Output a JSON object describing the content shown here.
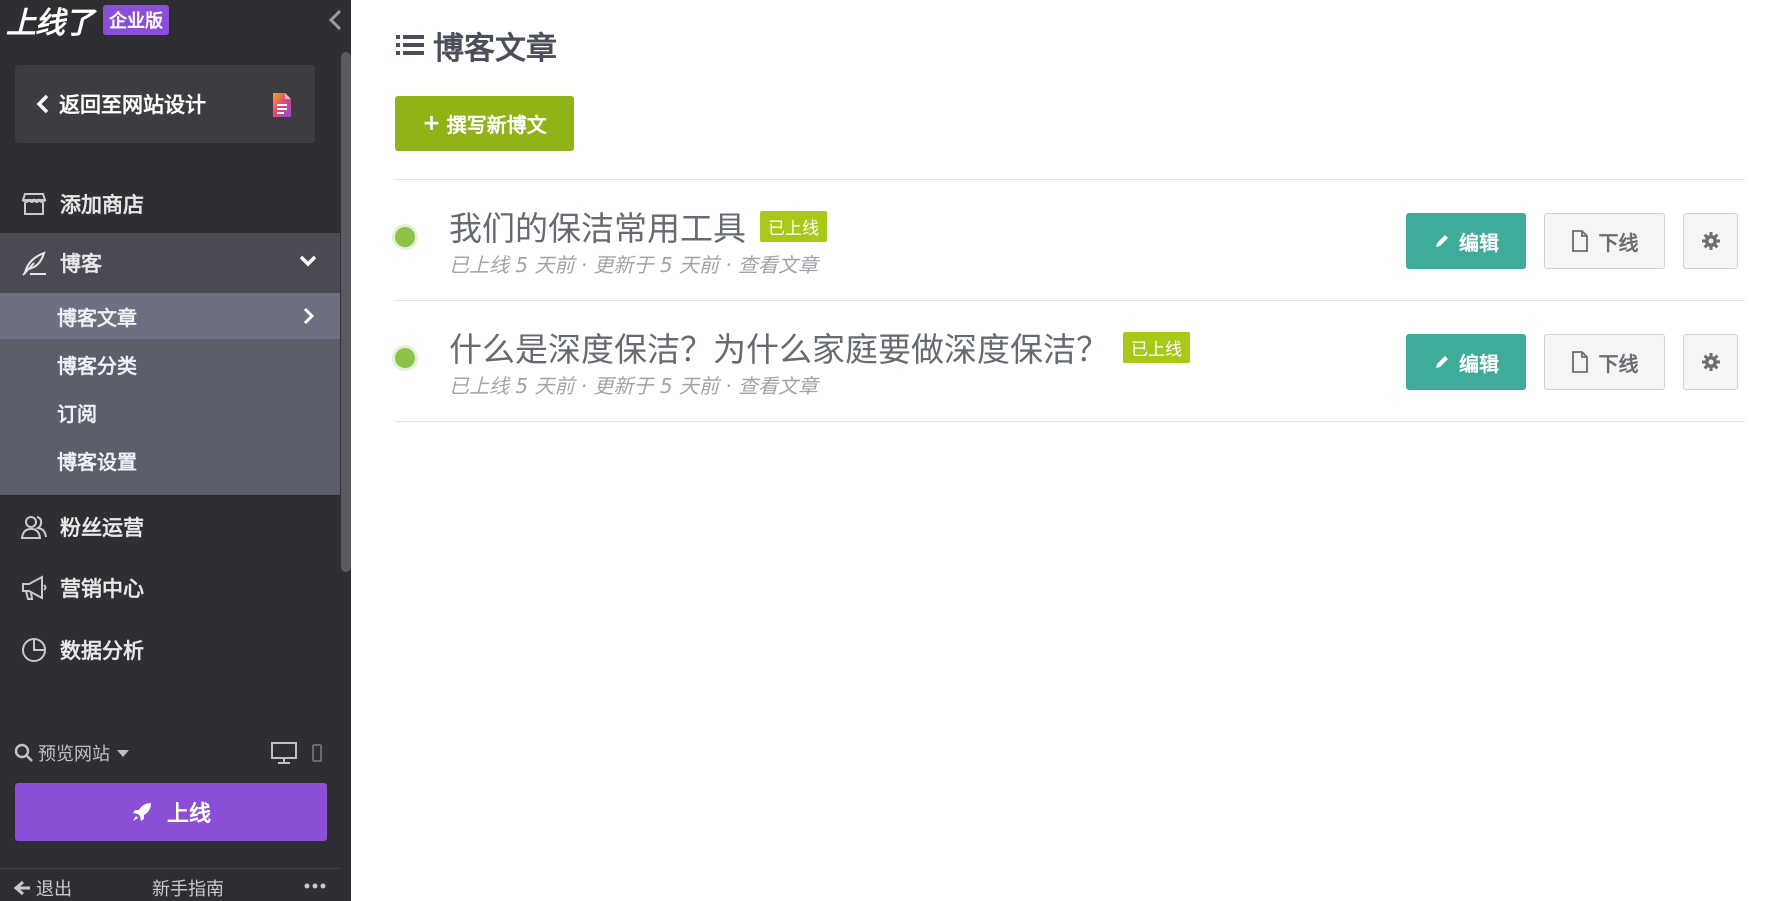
{
  "app": {
    "logo": "上线了",
    "edition_badge": "企业版"
  },
  "sidebar": {
    "back_label": "返回至网站设计",
    "items": [
      {
        "key": "shop",
        "label": "添加商店",
        "icon": "store-icon"
      },
      {
        "key": "blog",
        "label": "博客",
        "icon": "feather-icon",
        "expanded": true
      },
      {
        "key": "fans",
        "label": "粉丝运营",
        "icon": "users-icon"
      },
      {
        "key": "marketing",
        "label": "营销中心",
        "icon": "megaphone-icon"
      },
      {
        "key": "analytics",
        "label": "数据分析",
        "icon": "pie-chart-icon"
      }
    ],
    "blog_sub": [
      {
        "label": "博客文章",
        "active": true
      },
      {
        "label": "博客分类"
      },
      {
        "label": "订阅"
      },
      {
        "label": "博客设置"
      }
    ],
    "preview_label": "预览网站",
    "launch_label": "上线",
    "logout_label": "退出",
    "guide_label": "新手指南"
  },
  "main": {
    "title": "博客文章",
    "new_post_label": "撰写新博文",
    "posts": [
      {
        "title": "我们的保洁常用工具",
        "status": "已上线",
        "meta": "已上线 5 天前 · 更新于 5 天前 · ",
        "view_link": "查看文章",
        "edit_label": "编辑",
        "offline_label": "下线"
      },
      {
        "title": "什么是深度保洁？为什么家庭要做深度保洁？",
        "status": "已上线",
        "meta": "已上线 5 天前 · 更新于 5 天前 · ",
        "view_link": "查看文章",
        "edit_label": "编辑",
        "offline_label": "下线"
      }
    ]
  },
  "colors": {
    "sidebar_bg": "#2f2f33",
    "brand_purple": "#8a4fd6",
    "primary_green": "#90b418",
    "edit_teal": "#3fab9b",
    "status_dot": "#8bc34a",
    "badge_green": "#a8c81a"
  }
}
